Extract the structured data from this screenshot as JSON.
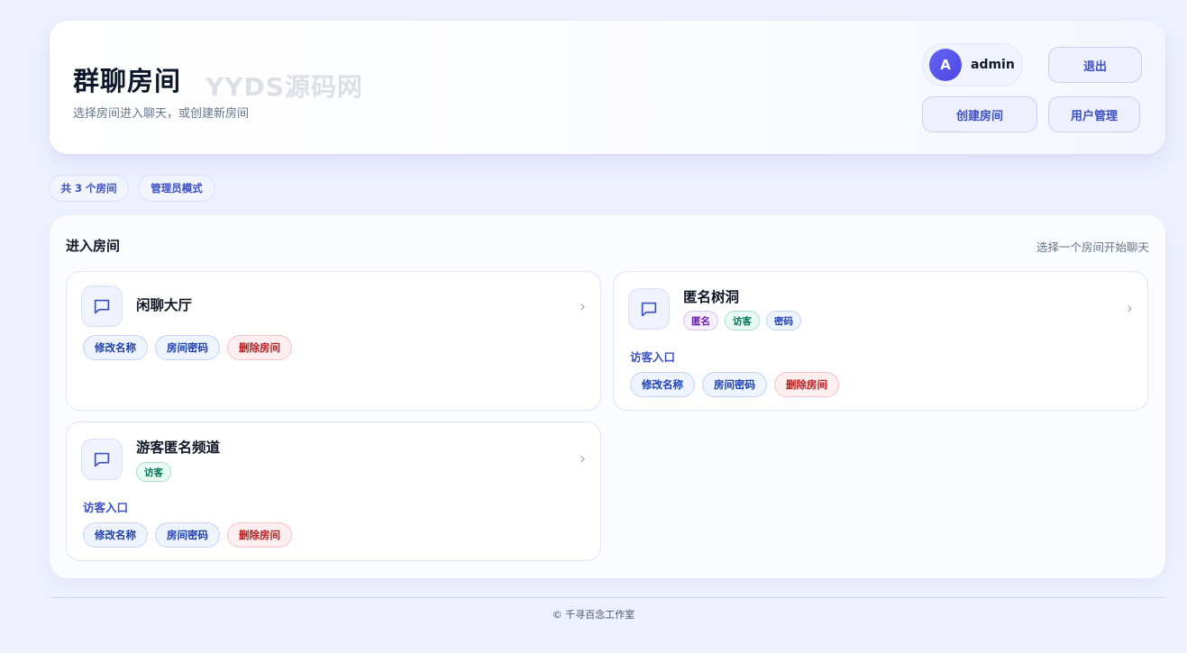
{
  "header": {
    "title": "群聊房间",
    "watermark": "YYDS源码网",
    "subtitle": "选择房间进入聊天，或创建新房间",
    "user": {
      "avatar_letter": "A",
      "name": "admin"
    },
    "logout_label": "退出",
    "create_label": "创建房间",
    "users_label": "用户管理"
  },
  "stats": {
    "count": "共 3 个房间",
    "mode": "管理员模式"
  },
  "section": {
    "title": "进入房间",
    "hint": "选择一个房间开始聊天"
  },
  "rooms": [
    {
      "name": "闲聊大厅",
      "tags": [],
      "guest_entry": "",
      "actions": {
        "rename": "修改名称",
        "password": "房间密码",
        "delete": "删除房间"
      }
    },
    {
      "name": "匿名树洞",
      "tags": [
        "匿名",
        "访客",
        "密码"
      ],
      "guest_entry": "访客入口",
      "actions": {
        "rename": "修改名称",
        "password": "房间密码",
        "delete": "删除房间"
      }
    },
    {
      "name": "游客匿名频道",
      "tags": [
        "访客"
      ],
      "guest_entry": "访客入口",
      "actions": {
        "rename": "修改名称",
        "password": "房间密码",
        "delete": "删除房间"
      }
    }
  ],
  "footer": "© 千寻百念工作室",
  "chevron_glyph": "›",
  "colors": {
    "accent": "#3b4fc4",
    "avatar": "#4f46e5",
    "danger": "#b91c1c",
    "guest": "#047857",
    "anonymous": "#6b21a8"
  },
  "icons": {
    "room": "chat-bubble-icon"
  }
}
